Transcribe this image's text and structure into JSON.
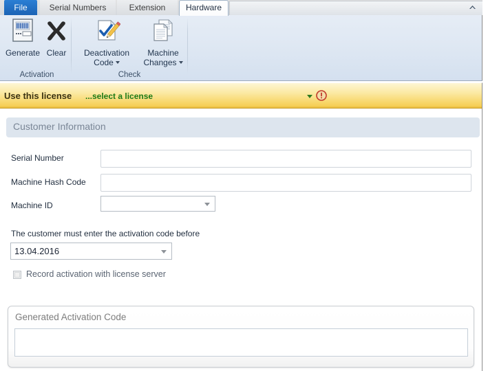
{
  "window": {
    "collapse_ribbon_icon": "chevron-up-icon"
  },
  "ribbon": {
    "tabs": [
      {
        "id": "file",
        "label": "File",
        "state": "file"
      },
      {
        "id": "serial",
        "label": "Serial Numbers",
        "state": "inactive"
      },
      {
        "id": "ext",
        "label": "Extension",
        "state": "inactive"
      },
      {
        "id": "hardware",
        "label": "Hardware",
        "state": "active"
      }
    ],
    "groups": [
      {
        "id": "activation",
        "label": "Activation",
        "buttons": [
          {
            "id": "generate",
            "label": "Generate",
            "icon": "license-key-icon",
            "has_menu": false
          },
          {
            "id": "clear",
            "label": "Clear",
            "icon": "x-cross-icon",
            "has_menu": false
          }
        ]
      },
      {
        "id": "check",
        "label": "Check",
        "buttons": [
          {
            "id": "deactivation-code",
            "label_line1": "Deactivation",
            "label_line2": "Code",
            "icon": "document-check-pencil-icon",
            "has_menu": true
          },
          {
            "id": "machine-changes",
            "label_line1": "Machine",
            "label_line2": "Changes",
            "icon": "documents-stack-icon",
            "has_menu": true
          }
        ]
      }
    ]
  },
  "license_bar": {
    "title": "Use this license",
    "link": "...select a license",
    "dropdown_icon": "chevron-down-icon",
    "error_icon": "error-exclamation-icon",
    "colors": {
      "start": "#fdf6d4",
      "end": "#e8b93c",
      "link": "#1d7a17",
      "error": "#c0392b"
    }
  },
  "customer_information": {
    "header": "Customer Information",
    "fields": {
      "serial_number": {
        "label": "Serial Number",
        "value": "",
        "placeholder": ""
      },
      "machine_hash_code": {
        "label": "Machine Hash Code",
        "value": "",
        "placeholder": ""
      },
      "machine_id": {
        "label": "Machine ID",
        "value": "",
        "options": []
      }
    },
    "deadline": {
      "hint": "The customer must enter the activation code before",
      "date": "13.04.2016"
    },
    "record_activation": {
      "label": "Record activation with license server",
      "checked": false,
      "enabled": false
    }
  },
  "generated_activation_code": {
    "title": "Generated Activation Code",
    "value": ""
  }
}
